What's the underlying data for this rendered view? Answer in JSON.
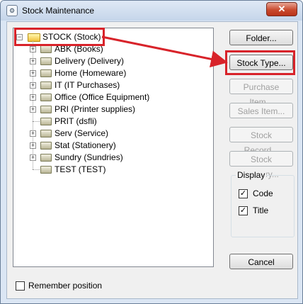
{
  "window": {
    "title": "Stock Maintenance",
    "icon": "app-icon",
    "close_label": "✕"
  },
  "tree": {
    "root": {
      "label": "STOCK (Stock)",
      "expander": "−",
      "icon": "open-folder-icon"
    },
    "items": [
      {
        "label": "ABK (Books)",
        "has_children": true,
        "expander": "+"
      },
      {
        "label": "Delivery (Delivery)",
        "has_children": true,
        "expander": "+"
      },
      {
        "label": "Home (Homeware)",
        "has_children": true,
        "expander": "+"
      },
      {
        "label": "IT (IT Purchases)",
        "has_children": true,
        "expander": "+"
      },
      {
        "label": "Office (Office Equipment)",
        "has_children": true,
        "expander": "+"
      },
      {
        "label": "PRI (Printer supplies)",
        "has_children": true,
        "expander": "+"
      },
      {
        "label": "PRIT (dsfli)",
        "has_children": false
      },
      {
        "label": "Serv (Service)",
        "has_children": true,
        "expander": "+"
      },
      {
        "label": "Stat (Stationery)",
        "has_children": true,
        "expander": "+"
      },
      {
        "label": "Sundry (Sundries)",
        "has_children": true,
        "expander": "+"
      },
      {
        "label": "TEST (TEST)",
        "has_children": false
      }
    ]
  },
  "buttons": {
    "folder": "Folder...",
    "stock_type": "Stock Type...",
    "purchase_item": "Purchase Item...",
    "sales_item": "Sales Item...",
    "stock_record": "Stock Record...",
    "stock_enquiry": "Stock Enquiry...",
    "cancel": "Cancel"
  },
  "display": {
    "label": "Display",
    "code": {
      "label": "Code",
      "checked": true,
      "mark": "✓"
    },
    "title": {
      "label": "Title",
      "checked": true,
      "mark": "✓"
    }
  },
  "remember_position": {
    "label": "Remember position",
    "checked": false
  },
  "annotation": {
    "color": "#d8232a"
  }
}
